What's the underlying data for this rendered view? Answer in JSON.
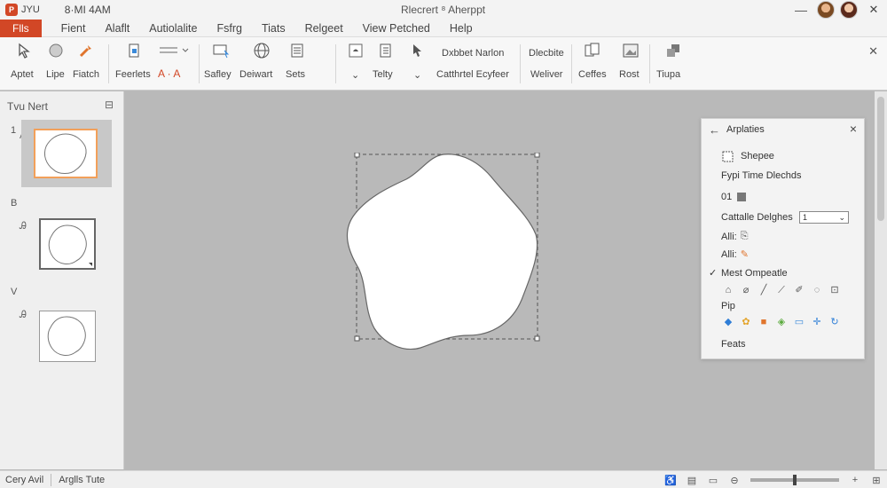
{
  "titlebar": {
    "app_badge": "P",
    "qat_label": "JYU",
    "clock": "8·MI 4AM",
    "document_title": "Rlecrert ⁸ Aherppt",
    "minimize": "—",
    "close": "✕"
  },
  "menubar": {
    "file": "Flls",
    "items": [
      "Fient",
      "Alaflt",
      "Autiolalite",
      "Fsfrg",
      "Tiats",
      "Relgeet",
      "View Petched",
      "Help"
    ]
  },
  "ribbon": {
    "groups": [
      {
        "label": "Aptet",
        "icon": "pointer-icon"
      },
      {
        "label": "Lipe",
        "icon": "circle-icon"
      },
      {
        "label": "Fiatch",
        "icon": "wand-icon"
      },
      {
        "label": "Feerlets",
        "icon": "document-icon"
      },
      {
        "label": "Safley",
        "icon": "presentation-icon"
      },
      {
        "label": "Deiwart",
        "icon": "globe-icon"
      },
      {
        "label": "Sets",
        "icon": "list-icon"
      },
      {
        "label": "Telty",
        "icon": "checklist-icon"
      },
      {
        "label": "Ceffes",
        "icon": "copy-icon"
      },
      {
        "label": "Rost",
        "icon": "picture-icon"
      },
      {
        "label": "Tiupa",
        "icon": "shapes-icon"
      }
    ],
    "text_top": [
      "Dxbbet Narlon",
      "Dlecbite"
    ],
    "text_bottom": [
      "Catthrtel Ecyfeer",
      "Weliver"
    ],
    "close": "✕"
  },
  "slides_panel": {
    "title": "Tvu Nert",
    "slides": [
      {
        "number": "1",
        "mark": "A"
      },
      {
        "number": "B",
        "mark": "Ꭿ"
      },
      {
        "number": "V",
        "mark": "Ꭿ"
      }
    ]
  },
  "format_pane": {
    "title": "Arplaties",
    "shape_label": "Shepee",
    "fill_label": "Fypi Time Dlechds",
    "number": "01",
    "select_label": "Cattalle Delghes",
    "select_value": "1",
    "alt_rows": [
      "Alli:",
      "Alli:"
    ],
    "checked_label": "Mest Ompeatle",
    "pip_label": "Pip",
    "footer": "Feats",
    "tool_colors": [
      "#2e7dd6",
      "#e4a52d",
      "#e0752d",
      "#5bab3e",
      "#3b8ad9",
      "#2f7fd7",
      "#2f7fd7"
    ]
  },
  "statusbar": {
    "left1": "Cery Avil",
    "left2": "Arglls Tute"
  }
}
